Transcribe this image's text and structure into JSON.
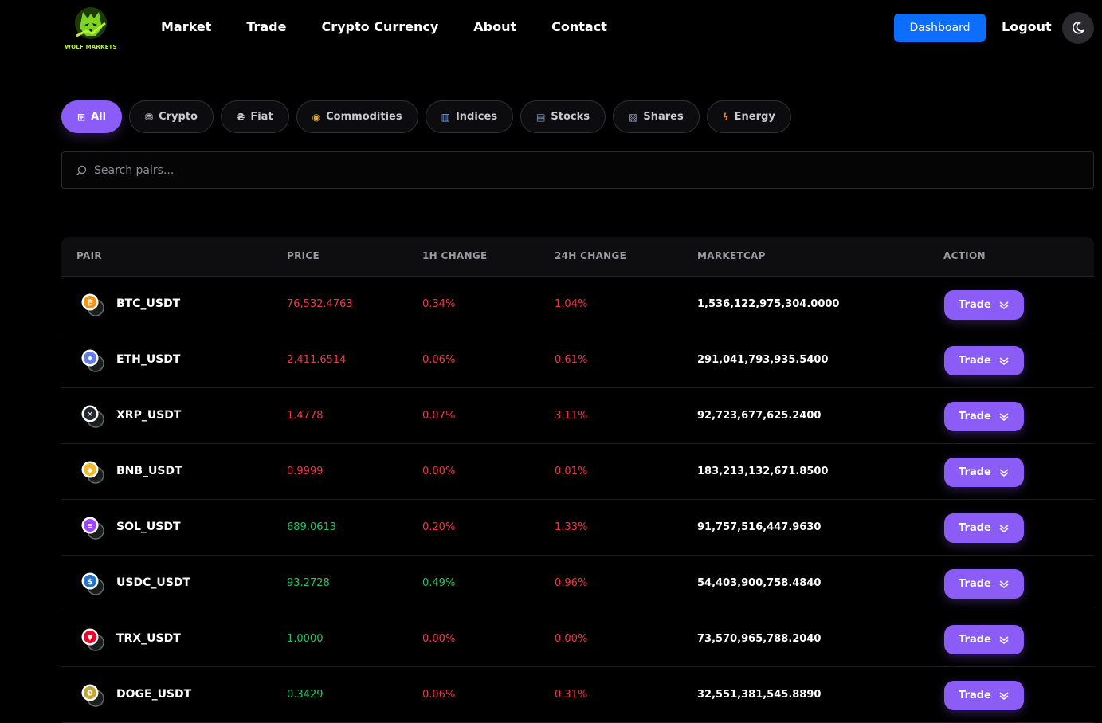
{
  "brand": {
    "name": "WOLF MARKETS"
  },
  "nav": [
    "Market",
    "Trade",
    "Crypto Currency",
    "About",
    "Contact"
  ],
  "header": {
    "dashboard_label": "Dashboard",
    "logout_label": "Logout"
  },
  "tabs": [
    {
      "label": "All",
      "icon": "grid-icon",
      "active": true
    },
    {
      "label": "Crypto",
      "icon": "coins-icon"
    },
    {
      "label": "Fiat",
      "icon": "currency-icon"
    },
    {
      "label": "Commodities",
      "icon": "money-bag-icon"
    },
    {
      "label": "Indices",
      "icon": "bar-chart-icon"
    },
    {
      "label": "Stocks",
      "icon": "building-icon"
    },
    {
      "label": "Shares",
      "icon": "line-chart-icon"
    },
    {
      "label": "Energy",
      "icon": "lightning-icon"
    }
  ],
  "search": {
    "placeholder": "Search pairs..."
  },
  "table": {
    "headers": {
      "pair": "PAIR",
      "price": "PRICE",
      "h1": "1H CHANGE",
      "h24": "24H CHANGE",
      "mcap": "MARKETCAP",
      "action": "ACTION"
    },
    "trade_label": "Trade",
    "rows": [
      {
        "pair": "BTC_USDT",
        "price": "76,532.4763",
        "price_dir": "red",
        "h1": "0.34%",
        "h1_dir": "red",
        "h24": "1.04%",
        "h24_dir": "red",
        "mcap": "1,536,122,975,304.0000",
        "coin_color": "#f7931a",
        "coin_icon": "bitcoin-icon"
      },
      {
        "pair": "ETH_USDT",
        "price": "2,411.6514",
        "price_dir": "red",
        "h1": "0.06%",
        "h1_dir": "red",
        "h24": "0.61%",
        "h24_dir": "red",
        "mcap": "291,041,793,935.5400",
        "coin_color": "#627eea",
        "coin_icon": "ethereum-icon"
      },
      {
        "pair": "XRP_USDT",
        "price": "1.4778",
        "price_dir": "red",
        "h1": "0.07%",
        "h1_dir": "red",
        "h24": "3.11%",
        "h24_dir": "red",
        "mcap": "92,723,677,625.2400",
        "coin_color": "#23292f",
        "coin_icon": "xrp-icon"
      },
      {
        "pair": "BNB_USDT",
        "price": "0.9999",
        "price_dir": "red",
        "h1": "0.00%",
        "h1_dir": "red",
        "h24": "0.01%",
        "h24_dir": "red",
        "mcap": "183,213,132,671.8500",
        "coin_color": "#f3ba2f",
        "coin_icon": "bnb-icon"
      },
      {
        "pair": "SOL_USDT",
        "price": "689.0613",
        "price_dir": "green",
        "h1": "0.20%",
        "h1_dir": "red",
        "h24": "1.33%",
        "h24_dir": "red",
        "mcap": "91,757,516,447.9630",
        "coin_color": "#9945ff",
        "coin_icon": "solana-icon"
      },
      {
        "pair": "USDC_USDT",
        "price": "93.2728",
        "price_dir": "green",
        "h1": "0.49%",
        "h1_dir": "green",
        "h24": "0.96%",
        "h24_dir": "red",
        "mcap": "54,403,900,758.4840",
        "coin_color": "#2775ca",
        "coin_icon": "usdc-icon"
      },
      {
        "pair": "TRX_USDT",
        "price": "1.0000",
        "price_dir": "green",
        "h1": "0.00%",
        "h1_dir": "red",
        "h24": "0.00%",
        "h24_dir": "red",
        "mcap": "73,570,965,788.2040",
        "coin_color": "#ef0027",
        "coin_icon": "tron-icon"
      },
      {
        "pair": "DOGE_USDT",
        "price": "0.3429",
        "price_dir": "green",
        "h1": "0.06%",
        "h1_dir": "red",
        "h24": "0.31%",
        "h24_dir": "red",
        "mcap": "32,551,381,545.8890",
        "coin_color": "#c2a633",
        "coin_icon": "dogecoin-icon"
      }
    ]
  },
  "colors": {
    "accent": "#8b5cf6",
    "primary_button": "#0d6efd",
    "negative": "#f23645",
    "positive": "#22c55e",
    "logo_green": "#b6f23a"
  }
}
